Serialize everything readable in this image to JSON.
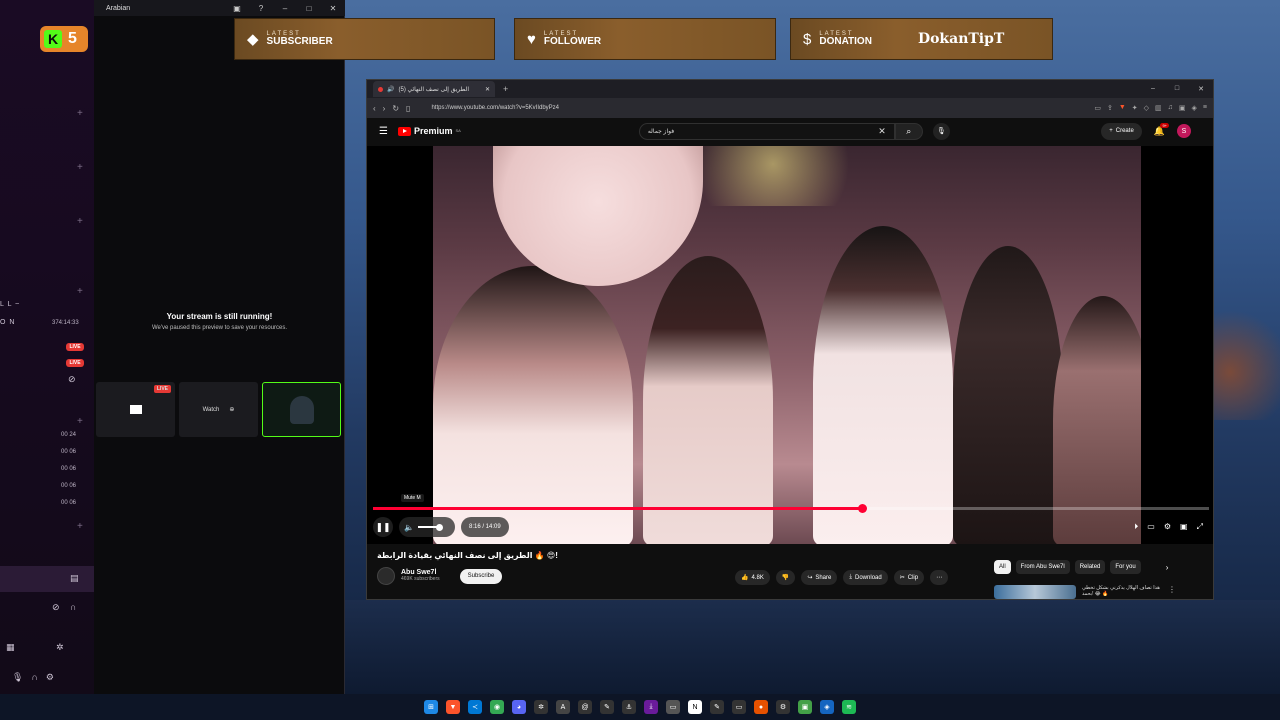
{
  "studio": {
    "app_name": "Arabian",
    "logo_badge": "5",
    "rail_label": "L L ~",
    "rail_user": "O N",
    "rail_timer": "374:14:33",
    "live_label": "LIVE",
    "counts": [
      "00 24",
      "00 06",
      "00 06",
      "00 06",
      "00 06"
    ],
    "message_title": "Your stream is still running!",
    "message_sub": "We've paused this preview to save your resources.",
    "thumb_live": "LIVE",
    "thumb_watch": "Watch"
  },
  "overlay": {
    "latest_word": "LATEST",
    "subscriber": "SUBSCRIBER",
    "follower": "FOLLOWER",
    "donation": "DONATION",
    "donation_value": "DokanTipT"
  },
  "browser": {
    "tab_title": "(5) الطريق إلى نصف النهائي",
    "url": "https://www.youtube.com/watch?v=5KvIIdbyPz4"
  },
  "youtube": {
    "brand": "Premium",
    "region": "SA",
    "search_value": "فواز جماله",
    "create_label": "Create",
    "notif_count": "9+",
    "avatar_letter": "S",
    "tooltip": "Mute  M",
    "time": "8:16 / 14:09",
    "progress_fraction": 0.585,
    "video_title": "الطريق إلى نصف النهائي بقيادة الرابطة 🔥 😍!",
    "channel_name": "Abu Swe7l",
    "subscribers": "469K subscribers",
    "subscribe_label": "Subscribe",
    "likes": "4.8K",
    "share_label": "Share",
    "download_label": "Download",
    "clip_label": "Clip",
    "chips": [
      "All",
      "From Abu Swe7l",
      "Related",
      "For you"
    ],
    "related_title": "هذا تصاف الهلال يذكرني بشكل تخطي بحمد! 😂 🔥"
  }
}
